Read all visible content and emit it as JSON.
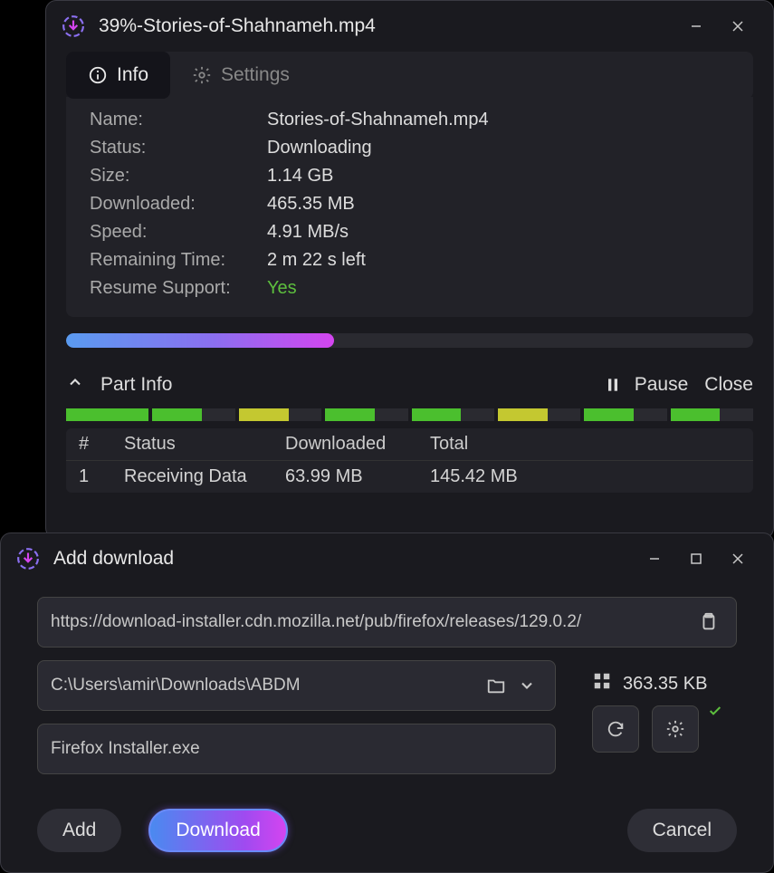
{
  "progressWindow": {
    "title": "39%-Stories-of-Shahnameh.mp4",
    "tabs": {
      "info": "Info",
      "settings": "Settings"
    },
    "info": {
      "name_label": "Name:",
      "name_value": "Stories-of-Shahnameh.mp4",
      "status_label": "Status:",
      "status_value": "Downloading",
      "size_label": "Size:",
      "size_value": "1.14 GB",
      "downloaded_label": "Downloaded:",
      "downloaded_value": "465.35 MB",
      "speed_label": "Speed:",
      "speed_value": "4.91 MB/s",
      "remaining_label": "Remaining Time:",
      "remaining_value": "2 m 22 s left",
      "resume_label": "Resume Support:",
      "resume_value": "Yes"
    },
    "progress_percent": 39,
    "actions": {
      "partinfo": "Part Info",
      "pause": "Pause",
      "close": "Close"
    },
    "table": {
      "headers": {
        "num": "#",
        "status": "Status",
        "downloaded": "Downloaded",
        "total": "Total"
      },
      "row": {
        "num": "1",
        "status": "Receiving Data",
        "downloaded": "63.99 MB",
        "total": "145.42 MB"
      }
    }
  },
  "addWindow": {
    "title": "Add download",
    "url": "https://download-installer.cdn.mozilla.net/pub/firefox/releases/129.0.2/",
    "path": "C:\\Users\\amir\\Downloads\\ABDM",
    "filename": "Firefox Installer.exe",
    "size": "363.35 KB",
    "buttons": {
      "add": "Add",
      "download": "Download",
      "cancel": "Cancel"
    }
  }
}
